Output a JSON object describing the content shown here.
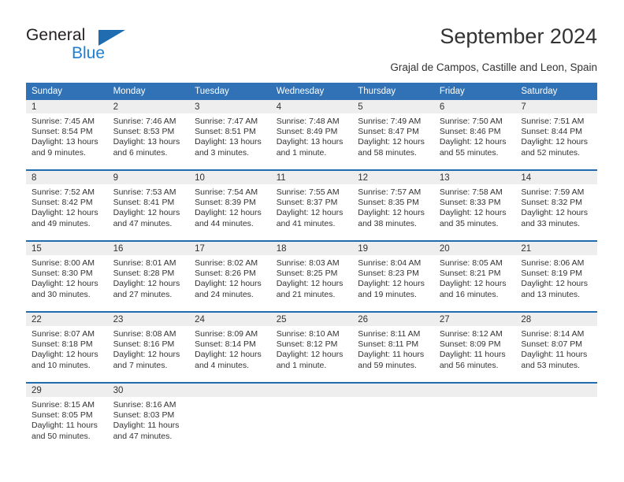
{
  "logo": {
    "primary_text": "General",
    "secondary_text": "Blue",
    "triangle_color": "#1f6cb0",
    "secondary_color": "#1f7fd0"
  },
  "header": {
    "title": "September 2024",
    "subtitle": "Grajal de Campos, Castille and Leon, Spain"
  },
  "theme": {
    "header_blue": "#3072b5",
    "separator_blue": "#1f6cb0",
    "daynum_band": "#eeeeee"
  },
  "calendar": {
    "weekday_headers": [
      "Sunday",
      "Monday",
      "Tuesday",
      "Wednesday",
      "Thursday",
      "Friday",
      "Saturday"
    ],
    "weeks": [
      [
        {
          "day": "1",
          "sunrise": "Sunrise: 7:45 AM",
          "sunset": "Sunset: 8:54 PM",
          "daylight": "Daylight: 13 hours and 9 minutes."
        },
        {
          "day": "2",
          "sunrise": "Sunrise: 7:46 AM",
          "sunset": "Sunset: 8:53 PM",
          "daylight": "Daylight: 13 hours and 6 minutes."
        },
        {
          "day": "3",
          "sunrise": "Sunrise: 7:47 AM",
          "sunset": "Sunset: 8:51 PM",
          "daylight": "Daylight: 13 hours and 3 minutes."
        },
        {
          "day": "4",
          "sunrise": "Sunrise: 7:48 AM",
          "sunset": "Sunset: 8:49 PM",
          "daylight": "Daylight: 13 hours and 1 minute."
        },
        {
          "day": "5",
          "sunrise": "Sunrise: 7:49 AM",
          "sunset": "Sunset: 8:47 PM",
          "daylight": "Daylight: 12 hours and 58 minutes."
        },
        {
          "day": "6",
          "sunrise": "Sunrise: 7:50 AM",
          "sunset": "Sunset: 8:46 PM",
          "daylight": "Daylight: 12 hours and 55 minutes."
        },
        {
          "day": "7",
          "sunrise": "Sunrise: 7:51 AM",
          "sunset": "Sunset: 8:44 PM",
          "daylight": "Daylight: 12 hours and 52 minutes."
        }
      ],
      [
        {
          "day": "8",
          "sunrise": "Sunrise: 7:52 AM",
          "sunset": "Sunset: 8:42 PM",
          "daylight": "Daylight: 12 hours and 49 minutes."
        },
        {
          "day": "9",
          "sunrise": "Sunrise: 7:53 AM",
          "sunset": "Sunset: 8:41 PM",
          "daylight": "Daylight: 12 hours and 47 minutes."
        },
        {
          "day": "10",
          "sunrise": "Sunrise: 7:54 AM",
          "sunset": "Sunset: 8:39 PM",
          "daylight": "Daylight: 12 hours and 44 minutes."
        },
        {
          "day": "11",
          "sunrise": "Sunrise: 7:55 AM",
          "sunset": "Sunset: 8:37 PM",
          "daylight": "Daylight: 12 hours and 41 minutes."
        },
        {
          "day": "12",
          "sunrise": "Sunrise: 7:57 AM",
          "sunset": "Sunset: 8:35 PM",
          "daylight": "Daylight: 12 hours and 38 minutes."
        },
        {
          "day": "13",
          "sunrise": "Sunrise: 7:58 AM",
          "sunset": "Sunset: 8:33 PM",
          "daylight": "Daylight: 12 hours and 35 minutes."
        },
        {
          "day": "14",
          "sunrise": "Sunrise: 7:59 AM",
          "sunset": "Sunset: 8:32 PM",
          "daylight": "Daylight: 12 hours and 33 minutes."
        }
      ],
      [
        {
          "day": "15",
          "sunrise": "Sunrise: 8:00 AM",
          "sunset": "Sunset: 8:30 PM",
          "daylight": "Daylight: 12 hours and 30 minutes."
        },
        {
          "day": "16",
          "sunrise": "Sunrise: 8:01 AM",
          "sunset": "Sunset: 8:28 PM",
          "daylight": "Daylight: 12 hours and 27 minutes."
        },
        {
          "day": "17",
          "sunrise": "Sunrise: 8:02 AM",
          "sunset": "Sunset: 8:26 PM",
          "daylight": "Daylight: 12 hours and 24 minutes."
        },
        {
          "day": "18",
          "sunrise": "Sunrise: 8:03 AM",
          "sunset": "Sunset: 8:25 PM",
          "daylight": "Daylight: 12 hours and 21 minutes."
        },
        {
          "day": "19",
          "sunrise": "Sunrise: 8:04 AM",
          "sunset": "Sunset: 8:23 PM",
          "daylight": "Daylight: 12 hours and 19 minutes."
        },
        {
          "day": "20",
          "sunrise": "Sunrise: 8:05 AM",
          "sunset": "Sunset: 8:21 PM",
          "daylight": "Daylight: 12 hours and 16 minutes."
        },
        {
          "day": "21",
          "sunrise": "Sunrise: 8:06 AM",
          "sunset": "Sunset: 8:19 PM",
          "daylight": "Daylight: 12 hours and 13 minutes."
        }
      ],
      [
        {
          "day": "22",
          "sunrise": "Sunrise: 8:07 AM",
          "sunset": "Sunset: 8:18 PM",
          "daylight": "Daylight: 12 hours and 10 minutes."
        },
        {
          "day": "23",
          "sunrise": "Sunrise: 8:08 AM",
          "sunset": "Sunset: 8:16 PM",
          "daylight": "Daylight: 12 hours and 7 minutes."
        },
        {
          "day": "24",
          "sunrise": "Sunrise: 8:09 AM",
          "sunset": "Sunset: 8:14 PM",
          "daylight": "Daylight: 12 hours and 4 minutes."
        },
        {
          "day": "25",
          "sunrise": "Sunrise: 8:10 AM",
          "sunset": "Sunset: 8:12 PM",
          "daylight": "Daylight: 12 hours and 1 minute."
        },
        {
          "day": "26",
          "sunrise": "Sunrise: 8:11 AM",
          "sunset": "Sunset: 8:11 PM",
          "daylight": "Daylight: 11 hours and 59 minutes."
        },
        {
          "day": "27",
          "sunrise": "Sunrise: 8:12 AM",
          "sunset": "Sunset: 8:09 PM",
          "daylight": "Daylight: 11 hours and 56 minutes."
        },
        {
          "day": "28",
          "sunrise": "Sunrise: 8:14 AM",
          "sunset": "Sunset: 8:07 PM",
          "daylight": "Daylight: 11 hours and 53 minutes."
        }
      ],
      [
        {
          "day": "29",
          "sunrise": "Sunrise: 8:15 AM",
          "sunset": "Sunset: 8:05 PM",
          "daylight": "Daylight: 11 hours and 50 minutes."
        },
        {
          "day": "30",
          "sunrise": "Sunrise: 8:16 AM",
          "sunset": "Sunset: 8:03 PM",
          "daylight": "Daylight: 11 hours and 47 minutes."
        },
        {
          "day": "",
          "sunrise": "",
          "sunset": "",
          "daylight": ""
        },
        {
          "day": "",
          "sunrise": "",
          "sunset": "",
          "daylight": ""
        },
        {
          "day": "",
          "sunrise": "",
          "sunset": "",
          "daylight": ""
        },
        {
          "day": "",
          "sunrise": "",
          "sunset": "",
          "daylight": ""
        },
        {
          "day": "",
          "sunrise": "",
          "sunset": "",
          "daylight": ""
        }
      ]
    ]
  }
}
